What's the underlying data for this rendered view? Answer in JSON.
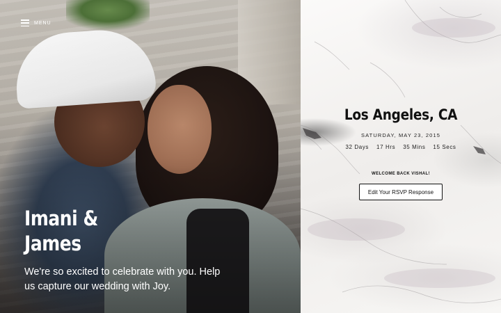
{
  "menu": {
    "label": "MENU",
    "icon": "hamburger-icon"
  },
  "hero": {
    "names_line1": "Imani &",
    "names_line2": "James",
    "tagline": "We're so excited to celebrate with you. Help us capture our wedding with Joy."
  },
  "event": {
    "location": "Los Angeles, CA",
    "date": "SATURDAY, MAY 23, 2015",
    "countdown": {
      "days": "32 Days",
      "hours": "17 Hrs",
      "mins": "35 Mins",
      "secs": "15 Secs"
    }
  },
  "rsvp": {
    "welcome": "WELCOME BACK VISHAL!",
    "button_label": "Edit Your RSVP Response"
  },
  "colors": {
    "text_dark": "#111111",
    "hero_text": "#ffffff",
    "panel_bg": "#f6f5f3"
  }
}
